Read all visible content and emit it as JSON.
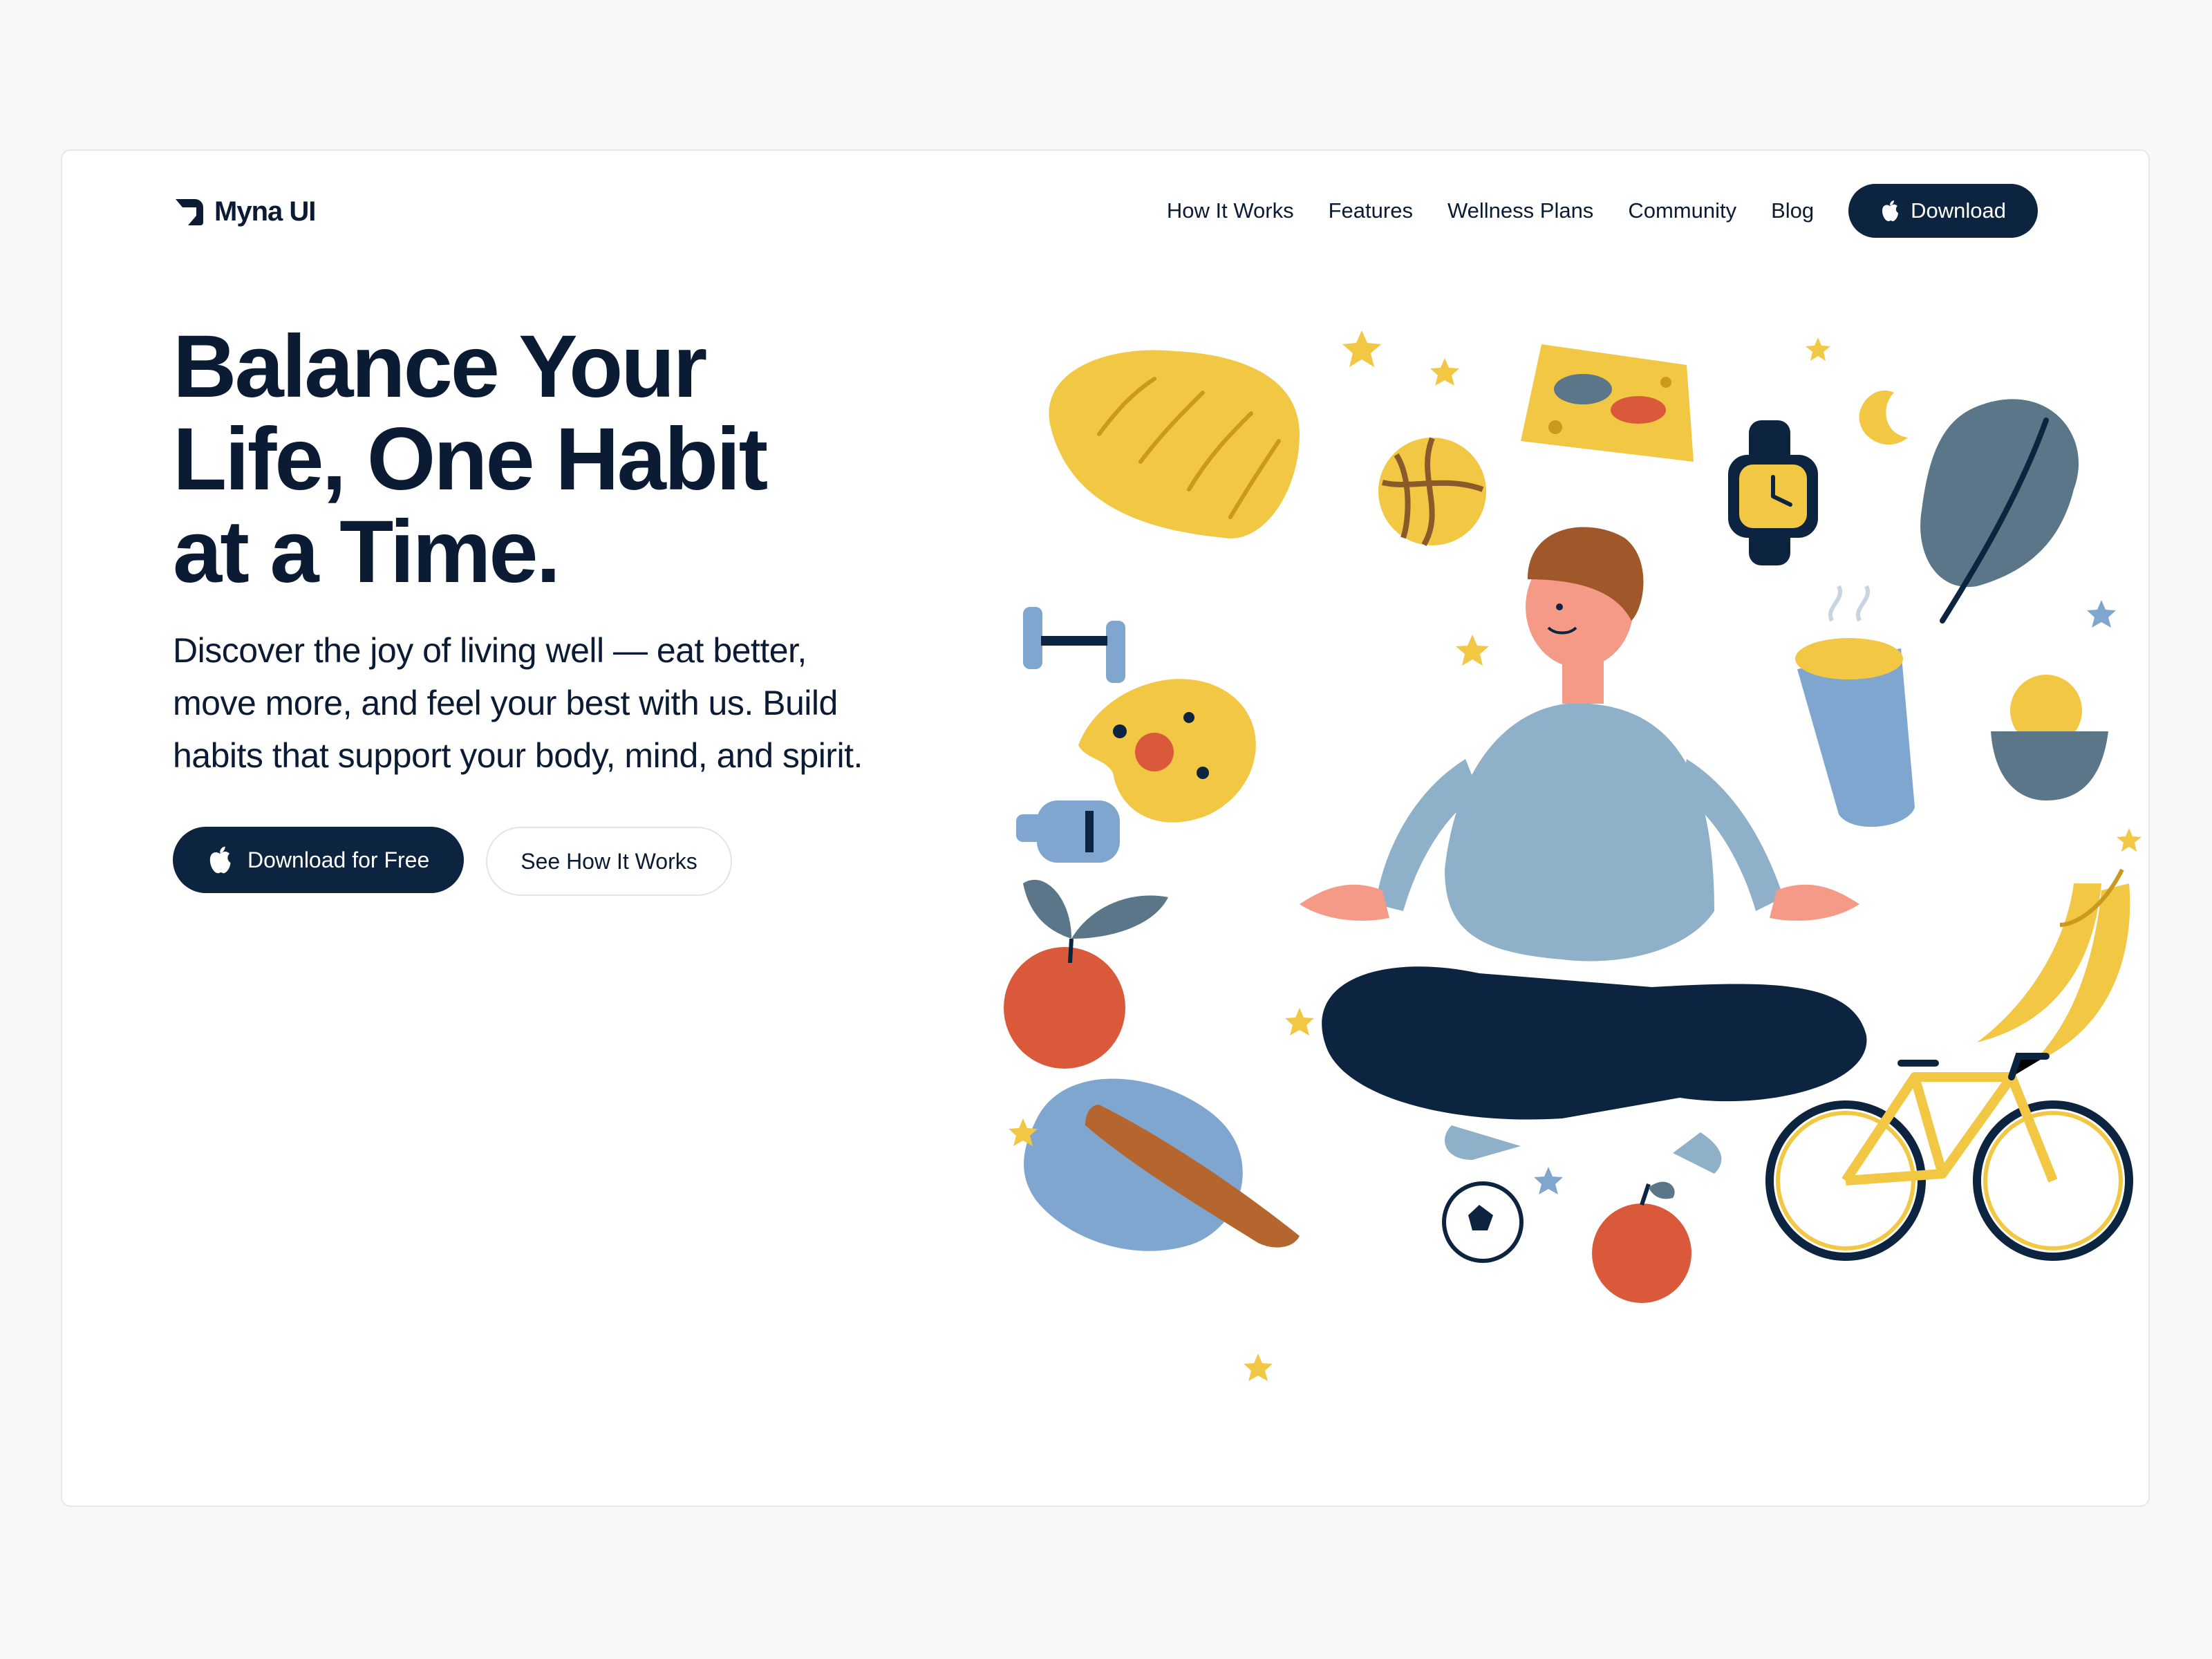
{
  "brand": {
    "name": "Myna UI"
  },
  "nav": {
    "links": [
      "How It Works",
      "Features",
      "Wellness Plans",
      "Community",
      "Blog"
    ],
    "download_label": "Download"
  },
  "hero": {
    "title_lines": [
      "Balance Your",
      "Life, One Habit",
      "at a Time."
    ],
    "subtitle_lines": [
      "Discover the joy of living well — eat better,",
      "move more, and feel your best with us. Build",
      "habits that support your body, mind, and spirit."
    ],
    "primary_cta": "Download for Free",
    "secondary_cta": "See How It Works"
  },
  "colors": {
    "page_bg": "#f7f8fa",
    "card_bg": "#ffffff",
    "primary": "#0d2440",
    "text": "#0b1b34",
    "accent_yellow": "#f2c744",
    "accent_blue": "#7fa6cf",
    "accent_red": "#d9593a"
  },
  "icons": [
    "myna-logo-icon",
    "apple-icon"
  ],
  "illustration": {
    "subject": "meditating-person-illustration",
    "items": [
      "bread-icon",
      "basketball-icon",
      "sponge-icon",
      "smartwatch-icon",
      "moon-icon",
      "leaf-icon",
      "dumbbell-icon",
      "pizza-icon",
      "coffee-cup-icon",
      "fruit-bowl-icon",
      "water-bottle-icon",
      "apple-plant-icon",
      "banana-icon",
      "baguette-icon",
      "soccer-ball-icon",
      "apple-icon",
      "bicycle-icon",
      "star-icon"
    ]
  }
}
